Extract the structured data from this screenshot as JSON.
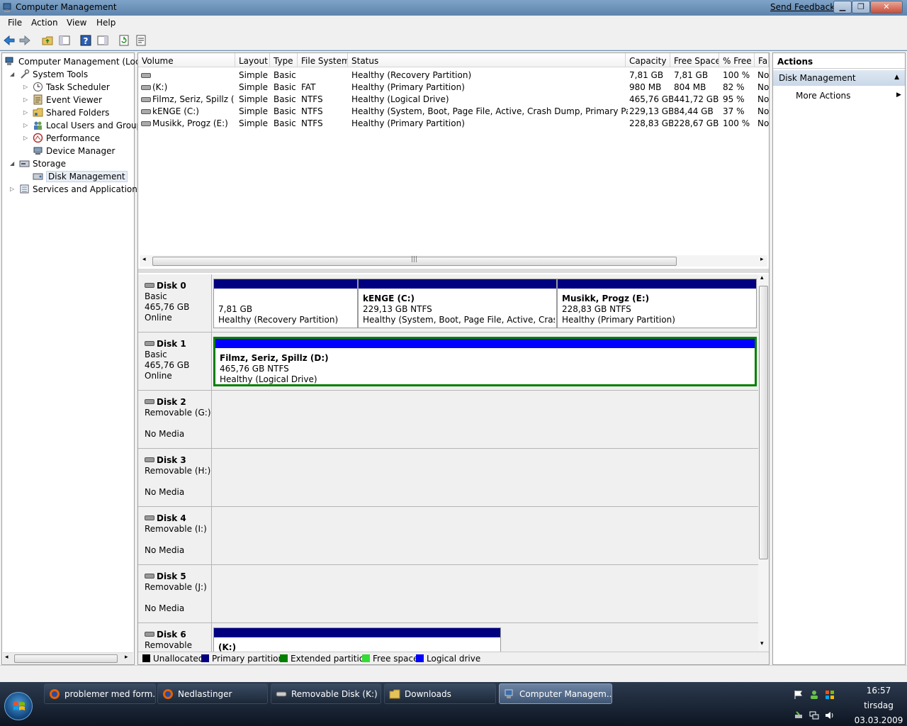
{
  "window": {
    "title": "Computer Management",
    "send_feedback": "Send Feedback"
  },
  "menu": [
    "File",
    "Action",
    "View",
    "Help"
  ],
  "tree": {
    "root": "Computer Management (Local",
    "items": [
      {
        "label": "System Tools",
        "level": 1,
        "expander": "expanded"
      },
      {
        "label": "Task Scheduler",
        "level": 2,
        "expander": "collapsed"
      },
      {
        "label": "Event Viewer",
        "level": 2,
        "expander": "collapsed"
      },
      {
        "label": "Shared Folders",
        "level": 2,
        "expander": "collapsed"
      },
      {
        "label": "Local Users and Groups",
        "level": 2,
        "expander": "collapsed"
      },
      {
        "label": "Performance",
        "level": 2,
        "expander": "collapsed"
      },
      {
        "label": "Device Manager",
        "level": 2,
        "expander": "none"
      },
      {
        "label": "Storage",
        "level": 1,
        "expander": "expanded"
      },
      {
        "label": "Disk Management",
        "level": 2,
        "expander": "none",
        "selected": true
      },
      {
        "label": "Services and Applications",
        "level": 1,
        "expander": "collapsed"
      }
    ]
  },
  "volumes": {
    "columns": [
      "Volume",
      "Layout",
      "Type",
      "File System",
      "Status",
      "Capacity",
      "Free Space",
      "% Free",
      "Fau"
    ],
    "rows": [
      [
        "",
        "Simple",
        "Basic",
        "",
        "Healthy (Recovery Partition)",
        "7,81 GB",
        "7,81 GB",
        "100 %",
        "No"
      ],
      [
        "(K:)",
        "Simple",
        "Basic",
        "FAT",
        "Healthy (Primary Partition)",
        "980 MB",
        "804 MB",
        "82 %",
        "No"
      ],
      [
        "Filmz, Seriz, Spillz (D:)",
        "Simple",
        "Basic",
        "NTFS",
        "Healthy (Logical Drive)",
        "465,76 GB",
        "441,72 GB",
        "95 %",
        "No"
      ],
      [
        "kENGE (C:)",
        "Simple",
        "Basic",
        "NTFS",
        "Healthy (System, Boot, Page File, Active, Crash Dump, Primary Partition)",
        "229,13 GB",
        "84,44 GB",
        "37 %",
        "No"
      ],
      [
        "Musikk, Progz (E:)",
        "Simple",
        "Basic",
        "NTFS",
        "Healthy (Primary Partition)",
        "228,83 GB",
        "228,67 GB",
        "100 %",
        "No"
      ]
    ]
  },
  "disks": [
    {
      "name": "Disk 0",
      "line1": "Basic",
      "line2": "465,76 GB",
      "line3": "Online",
      "partitions": [
        {
          "label": "",
          "size": "7,81 GB",
          "status": "Healthy (Recovery Partition)",
          "kind": "primary"
        },
        {
          "label": "kENGE  (C:)",
          "size": "229,13 GB NTFS",
          "status": "Healthy (System, Boot, Page File, Active, Crash Dun",
          "kind": "primary"
        },
        {
          "label": "Musikk, Progz  (E:)",
          "size": "228,83 GB NTFS",
          "status": "Healthy (Primary Partition)",
          "kind": "primary"
        }
      ]
    },
    {
      "name": "Disk 1",
      "line1": "Basic",
      "line2": "465,76 GB",
      "line3": "Online",
      "partitions": [
        {
          "label": "Filmz, Seriz, Spillz  (D:)",
          "size": "465,76 GB NTFS",
          "status": "Healthy (Logical Drive)",
          "kind": "logical"
        }
      ]
    },
    {
      "name": "Disk 2",
      "line1": "Removable (G:)",
      "line2": "",
      "line3": "No Media",
      "partitions": []
    },
    {
      "name": "Disk 3",
      "line1": "Removable (H:)",
      "line2": "",
      "line3": "No Media",
      "partitions": []
    },
    {
      "name": "Disk 4",
      "line1": "Removable (I:)",
      "line2": "",
      "line3": "No Media",
      "partitions": []
    },
    {
      "name": "Disk 5",
      "line1": "Removable (J:)",
      "line2": "",
      "line3": "No Media",
      "partitions": []
    },
    {
      "name": "Disk 6",
      "line1": "Removable",
      "line2": "",
      "line3": "",
      "partitions": [
        {
          "label": "(K:)",
          "size": "",
          "status": "",
          "kind": "primary"
        }
      ]
    }
  ],
  "legend": [
    {
      "label": "Unallocated",
      "color": "#000000"
    },
    {
      "label": "Primary partition",
      "color": "#000080"
    },
    {
      "label": "Extended partition",
      "color": "#008000"
    },
    {
      "label": "Free space",
      "color": "#33dd33"
    },
    {
      "label": "Logical drive",
      "color": "#0000ff"
    }
  ],
  "actions": {
    "header": "Actions",
    "section": "Disk Management",
    "more": "More Actions"
  },
  "taskbar": {
    "tasks": [
      {
        "label": "problemer med form...",
        "icon": "firefox-icon"
      },
      {
        "label": "Nedlastinger",
        "icon": "firefox-icon"
      },
      {
        "label": "Removable Disk (K:)",
        "icon": "drive-icon"
      },
      {
        "label": "Downloads",
        "icon": "folder-icon"
      },
      {
        "label": "Computer Managem...",
        "icon": "computer-management-icon",
        "active": true
      }
    ],
    "clock": {
      "time": "16:57",
      "day": "tirsdag",
      "date": "03.03.2009"
    }
  }
}
